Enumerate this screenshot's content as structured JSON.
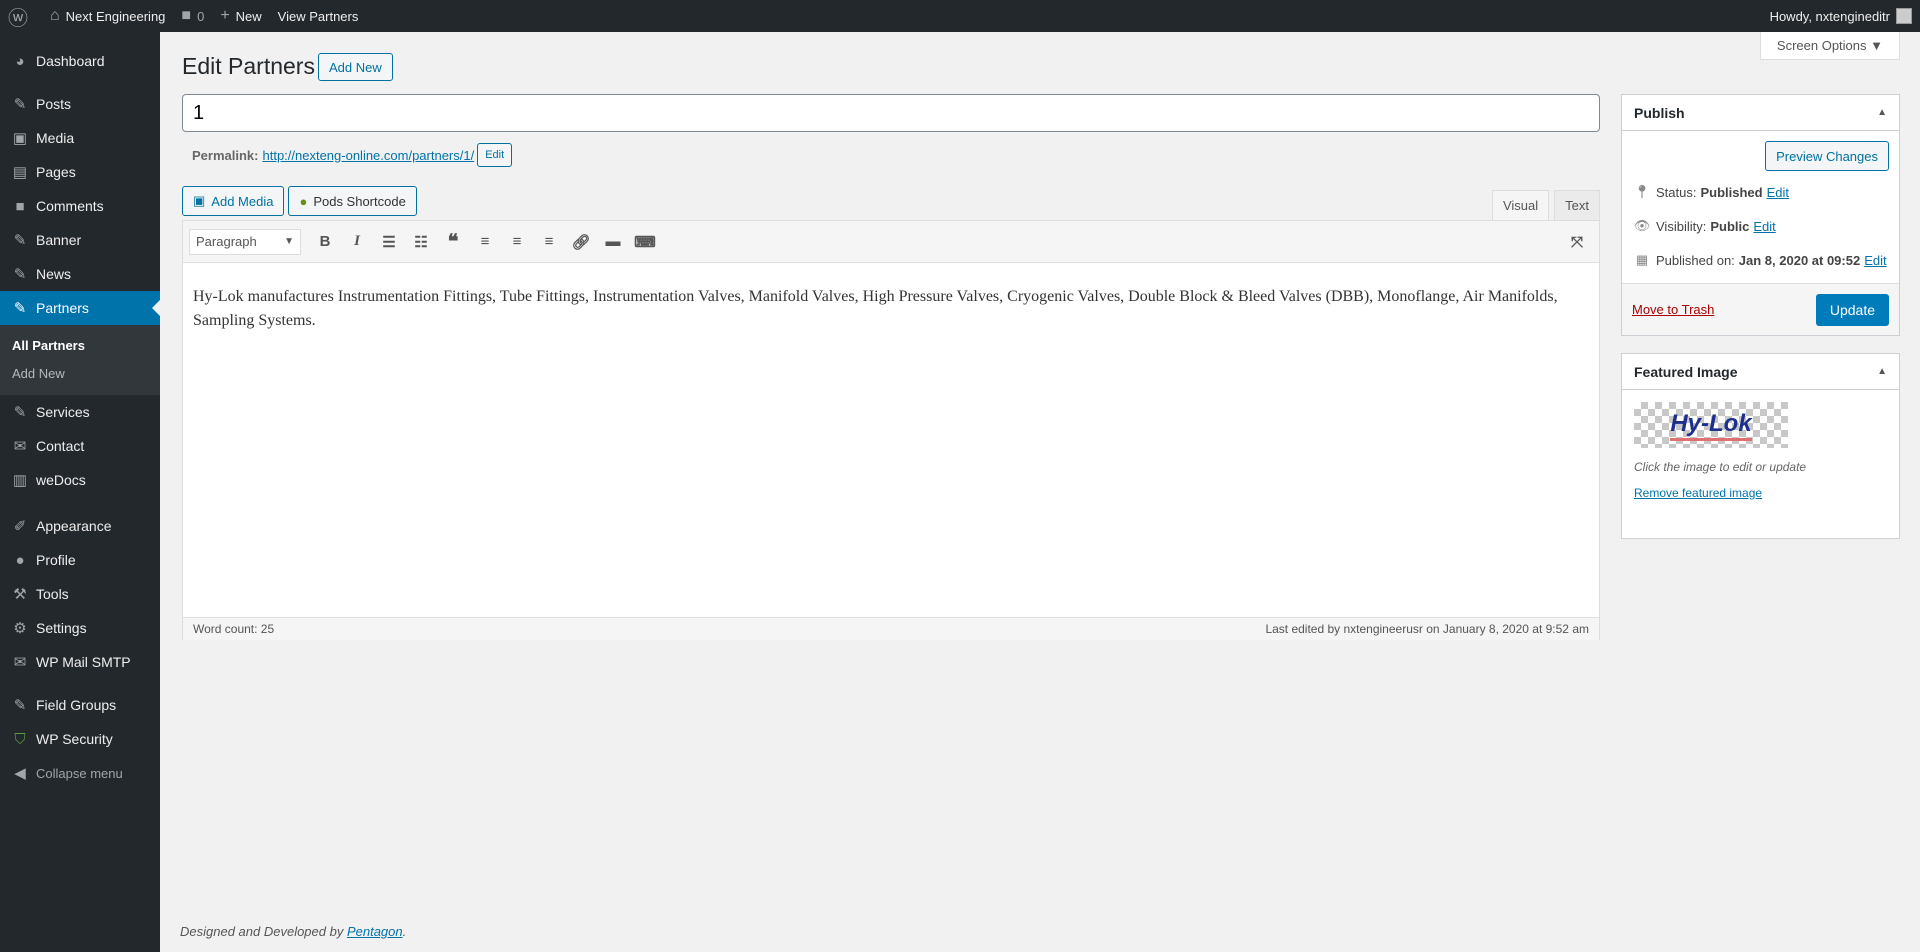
{
  "adminbar": {
    "site": "Next Engineering",
    "comments": "0",
    "new": "New",
    "view": "View Partners",
    "howdy": "Howdy, nxtengineditr"
  },
  "menu": {
    "dashboard": "Dashboard",
    "posts": "Posts",
    "media": "Media",
    "pages": "Pages",
    "comments": "Comments",
    "banner": "Banner",
    "news": "News",
    "partners": "Partners",
    "all_partners": "All Partners",
    "add_new": "Add New",
    "services": "Services",
    "contact": "Contact",
    "wedocs": "weDocs",
    "appearance": "Appearance",
    "profile": "Profile",
    "tools": "Tools",
    "settings": "Settings",
    "wpmail": "WP Mail SMTP",
    "fieldgroups": "Field Groups",
    "wpsecurity": "WP Security",
    "collapse": "Collapse menu"
  },
  "screen_options": "Screen Options ▼",
  "page": {
    "title": "Edit Partners",
    "add_new": "Add New",
    "post_title": "1",
    "permalink_label": "Permalink:",
    "permalink": "http://nexteng-online.com/partners/1/",
    "permalink_edit": "Edit"
  },
  "editor": {
    "add_media": "Add Media",
    "pods": "Pods Shortcode",
    "tab_visual": "Visual",
    "tab_text": "Text",
    "format": "Paragraph",
    "content": "Hy-Lok manufactures Instrumentation Fittings, Tube Fittings, Instrumentation Valves, Manifold Valves, High Pressure Valves, Cryogenic Valves, Double Block & Bleed Valves (DBB), Monoflange, Air Manifolds, Sampling Systems.",
    "word_count": "Word count: 25",
    "last_edited": "Last edited by nxtengineerusr on January 8, 2020 at 9:52 am"
  },
  "publish": {
    "title": "Publish",
    "preview": "Preview Changes",
    "status_label": "Status:",
    "status": "Published",
    "visibility_label": "Visibility:",
    "visibility": "Public",
    "published_label": "Published on:",
    "published": "Jan 8, 2020 at 09:52",
    "edit": "Edit",
    "trash": "Move to Trash",
    "update": "Update"
  },
  "featured": {
    "title": "Featured Image",
    "logo": "Hy-Lok",
    "hint": "Click the image to edit or update",
    "remove": "Remove featured image"
  },
  "footer": {
    "text": "Designed and Developed by ",
    "link": "Pentagon",
    "end": "."
  }
}
